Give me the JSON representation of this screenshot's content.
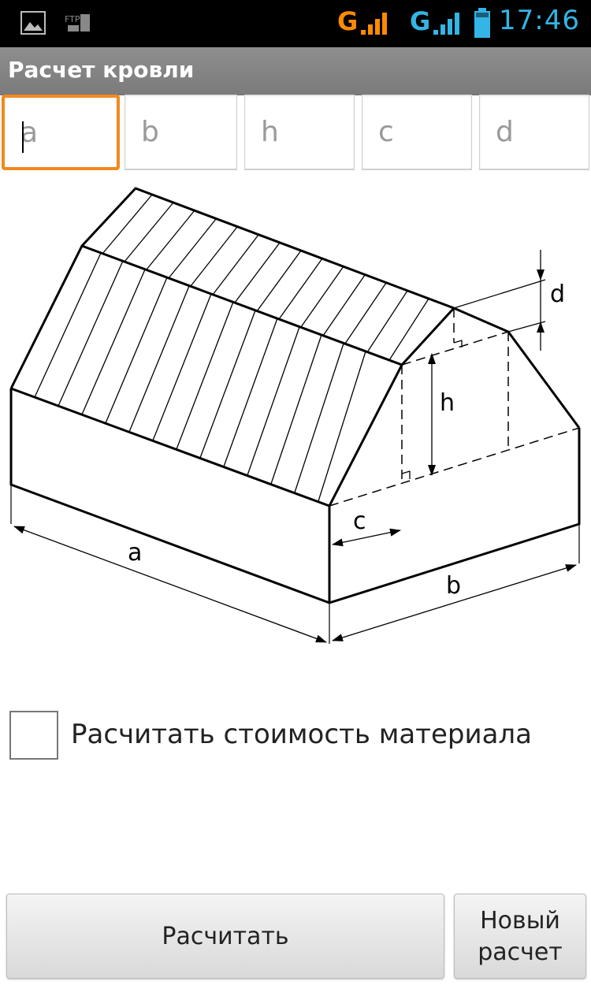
{
  "status_bar": {
    "time": "17:46",
    "network1": "G",
    "network2": "G",
    "icons": [
      "gallery-icon",
      "ftp-icon",
      "signal-icon",
      "battery-icon"
    ],
    "colors": {
      "network1": "#ff8a00",
      "network2": "#33b5e5",
      "time": "#33b5e5"
    }
  },
  "app": {
    "title": "Расчет кровли"
  },
  "inputs": [
    {
      "name": "a",
      "placeholder": "a"
    },
    {
      "name": "b",
      "placeholder": "b"
    },
    {
      "name": "h",
      "placeholder": "h"
    },
    {
      "name": "c",
      "placeholder": "c"
    },
    {
      "name": "d",
      "placeholder": "d"
    }
  ],
  "diagram": {
    "labels": {
      "a": "a",
      "b": "b",
      "h": "h",
      "c": "c",
      "d": "d"
    }
  },
  "checkbox": {
    "label": "Расчитать стоимость материала",
    "checked": false
  },
  "buttons": {
    "calculate": "Расчитать",
    "new_line1": "Новый",
    "new_line2": "расчет"
  },
  "accent_color": "#f2891d"
}
